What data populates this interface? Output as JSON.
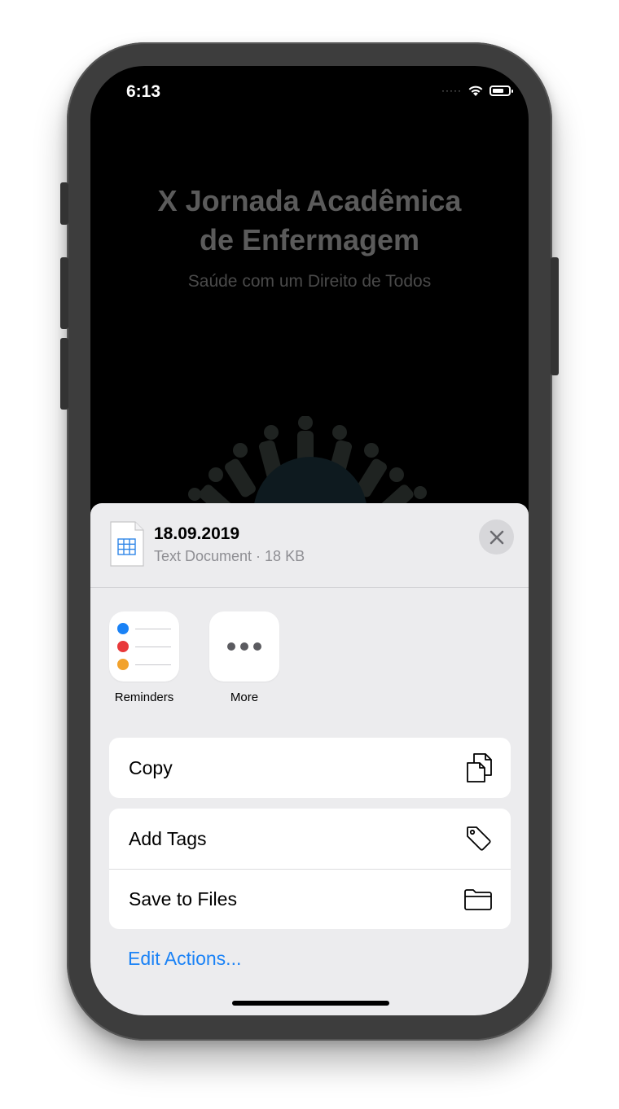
{
  "status_bar": {
    "time": "6:13"
  },
  "app": {
    "title": "X Jornada Acadêmica\nde Enfermagem",
    "subtitle": "Saúde com um Direito de Todos"
  },
  "share_sheet": {
    "file_name": "18.09.2019",
    "file_meta": "Text Document · 18 KB",
    "apps": [
      {
        "label": "Reminders",
        "icon": "reminders-icon"
      },
      {
        "label": "More",
        "icon": "more-icon"
      }
    ],
    "reminder_colors": [
      "#1a82f6",
      "#e8393b",
      "#f2a22c"
    ],
    "actions": {
      "copy": {
        "label": "Copy",
        "icon": "copy-icon"
      },
      "add_tags": {
        "label": "Add Tags",
        "icon": "tag-icon"
      },
      "save_to_files": {
        "label": "Save to Files",
        "icon": "folder-icon"
      }
    },
    "edit_actions": "Edit Actions..."
  },
  "colors": {
    "accent": "#1a82f6",
    "sheet_background": "#ececee"
  }
}
